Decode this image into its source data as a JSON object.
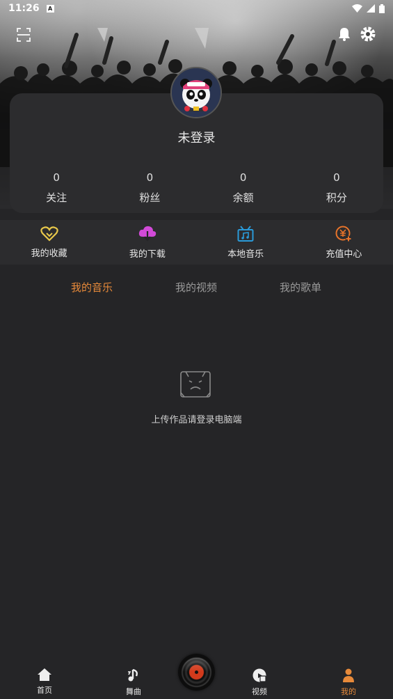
{
  "status_bar": {
    "time": "11:26",
    "badge": "A"
  },
  "profile": {
    "login_text": "未登录",
    "stats": [
      {
        "value": "0",
        "label": "关注"
      },
      {
        "value": "0",
        "label": "粉丝"
      },
      {
        "value": "0",
        "label": "余额"
      },
      {
        "value": "0",
        "label": "积分"
      }
    ]
  },
  "quick_actions": [
    {
      "label": "我的收藏",
      "icon": "heart-icon",
      "color": "#e8c84a"
    },
    {
      "label": "我的下载",
      "icon": "cloud-download-icon",
      "color": "#d24ad8"
    },
    {
      "label": "本地音乐",
      "icon": "local-music-icon",
      "color": "#2a9ad8"
    },
    {
      "label": "充值中心",
      "icon": "recharge-icon",
      "color": "#e8742a"
    }
  ],
  "tabs": [
    {
      "label": "我的音乐",
      "active": true
    },
    {
      "label": "我的视频",
      "active": false
    },
    {
      "label": "我的歌单",
      "active": false
    }
  ],
  "empty_state": {
    "text": "上传作品请登录电脑端",
    "icon": "empty-face-icon"
  },
  "bottom_nav": [
    {
      "label": "首页",
      "icon": "home-icon"
    },
    {
      "label": "舞曲",
      "icon": "music-note-icon"
    },
    {
      "label": "视频",
      "icon": "video-icon"
    },
    {
      "label": "我的",
      "icon": "user-icon",
      "active": true
    }
  ],
  "colors": {
    "accent": "#e88a3a",
    "background": "#252527",
    "card": "#2c2c2e"
  }
}
